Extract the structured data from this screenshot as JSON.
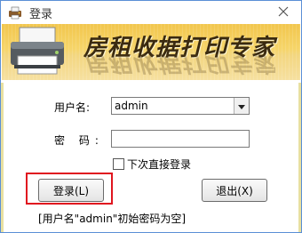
{
  "window": {
    "title": "登录"
  },
  "banner": {
    "title": "房租收据打印专家"
  },
  "form": {
    "username_label": "用户名:",
    "username_value": "admin",
    "password_label": "密  码:",
    "password_value": "",
    "auto_login_label": "下次直接登录",
    "auto_login_checked": false
  },
  "buttons": {
    "login_label": "登录(L)",
    "exit_label": "退出(X)"
  },
  "hint": "[用户名\"admin\"初始密码为空]",
  "icons": {
    "app": "app-printer-icon",
    "close": "close-icon",
    "dropdown": "chevron-down-icon",
    "banner": "printer-icon"
  },
  "colors": {
    "highlight": "#e0151f",
    "banner": "#f2c64d"
  }
}
